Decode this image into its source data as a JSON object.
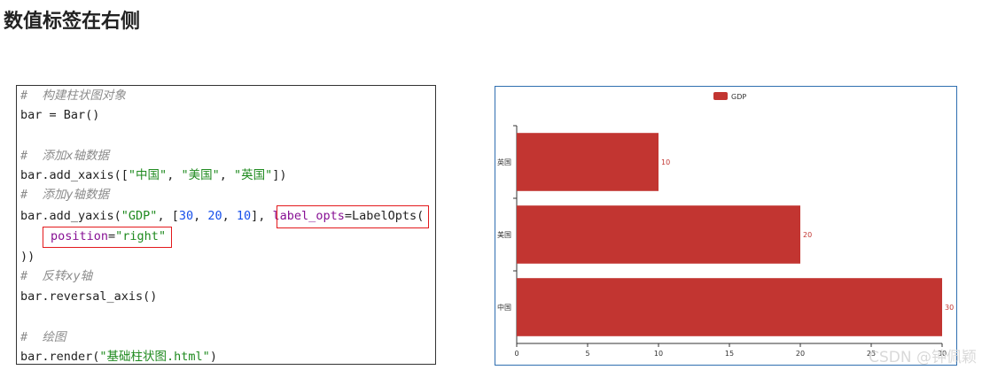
{
  "page_title": "数值标签在右侧",
  "code": {
    "lines": [
      {
        "kind": "comment",
        "text": "#  构建柱状图对象"
      },
      {
        "kind": "plain",
        "text": "bar = Bar()"
      },
      {
        "kind": "comment",
        "text": "#  添加x轴数据"
      },
      {
        "kind": "call",
        "prefix": "bar.add_xaxis([",
        "args": [
          "\"中国\"",
          "\"美国\"",
          "\"英国\""
        ],
        "suffix": "])"
      },
      {
        "kind": "comment",
        "text": "#  添加y轴数据"
      },
      {
        "kind": "yaxis",
        "prefix": "bar.add_yaxis(",
        "name": "\"GDP\"",
        "sep1": ", [",
        "v1": "30",
        "v2": "20",
        "v3": "10",
        "sep2": "], ",
        "kw": "label_opts",
        "eq": "=LabelOpts("
      },
      {
        "kind": "kwline",
        "kw": "position",
        "val": "\"right\""
      },
      {
        "kind": "plain",
        "text": "))"
      },
      {
        "kind": "comment",
        "text": "#  反转xy轴"
      },
      {
        "kind": "plain",
        "text": "bar.reversal_axis()"
      },
      {
        "kind": "comment",
        "text": "#  绘图"
      },
      {
        "kind": "render",
        "prefix": "bar.render(",
        "arg": "\"基础柱状图.html\"",
        "suffix": ")"
      }
    ]
  },
  "chart_data": {
    "type": "bar",
    "orientation": "horizontal",
    "categories": [
      "中国",
      "美国",
      "英国"
    ],
    "series": [
      {
        "name": "GDP",
        "values": [
          30,
          20,
          10
        ],
        "color": "#c23531"
      }
    ],
    "xlim": [
      0,
      30
    ],
    "x_ticks": [
      "0",
      "5",
      "10",
      "15",
      "20",
      "25",
      "30"
    ],
    "label_position": "right",
    "legend": {
      "position": "top-center",
      "items": [
        "GDP"
      ]
    }
  },
  "watermark": "CSDN @钟佩颖"
}
